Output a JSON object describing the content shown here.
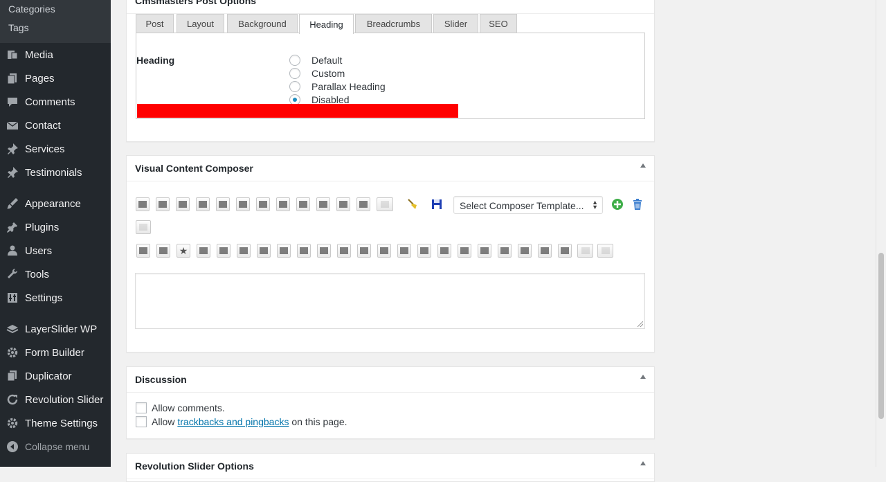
{
  "sidebar": {
    "submenu": [
      "Categories",
      "Tags"
    ],
    "items": [
      {
        "label": "Media",
        "icon": "media-icon"
      },
      {
        "label": "Pages",
        "icon": "pages-icon"
      },
      {
        "label": "Comments",
        "icon": "comments-icon"
      },
      {
        "label": "Contact",
        "icon": "contact-icon"
      },
      {
        "label": "Services",
        "icon": "pin-icon"
      },
      {
        "label": "Testimonials",
        "icon": "pin-icon"
      },
      {
        "label": "Appearance",
        "icon": "appearance-icon"
      },
      {
        "label": "Plugins",
        "icon": "plugins-icon"
      },
      {
        "label": "Users",
        "icon": "users-icon"
      },
      {
        "label": "Tools",
        "icon": "tools-icon"
      },
      {
        "label": "Settings",
        "icon": "settings-icon"
      },
      {
        "label": "LayerSlider WP",
        "icon": "layerslider-icon"
      },
      {
        "label": "Form Builder",
        "icon": "gear-icon"
      },
      {
        "label": "Duplicator",
        "icon": "duplicator-icon"
      },
      {
        "label": "Revolution Slider",
        "icon": "refresh-icon"
      },
      {
        "label": "Theme Settings",
        "icon": "gear-icon"
      }
    ],
    "collapse_label": "Collapse menu"
  },
  "post_options": {
    "title": "Cmsmasters Post Options",
    "tabs": [
      "Post",
      "Layout",
      "Background",
      "Heading",
      "Breadcrumbs",
      "Slider",
      "SEO"
    ],
    "active_tab": "Heading",
    "field_label": "Heading",
    "radio_options": [
      {
        "label": "Default",
        "checked": false
      },
      {
        "label": "Custom",
        "checked": false
      },
      {
        "label": "Parallax Heading",
        "checked": false
      },
      {
        "label": "Disabled",
        "checked": true
      }
    ]
  },
  "composer": {
    "title": "Visual Content Composer",
    "template_select": "Select Composer Template...",
    "textarea_value": ""
  },
  "discussion": {
    "title": "Discussion",
    "allow_comments": "Allow comments.",
    "allow_pre": "Allow ",
    "trackbacks_link": "trackbacks and pingbacks",
    "allow_post": " on this page."
  },
  "revolution": {
    "title": "Revolution Slider Options"
  },
  "colors": {
    "sidebar_bg": "#23282d",
    "accent": "#0073aa",
    "redaction": "#ff0000"
  }
}
